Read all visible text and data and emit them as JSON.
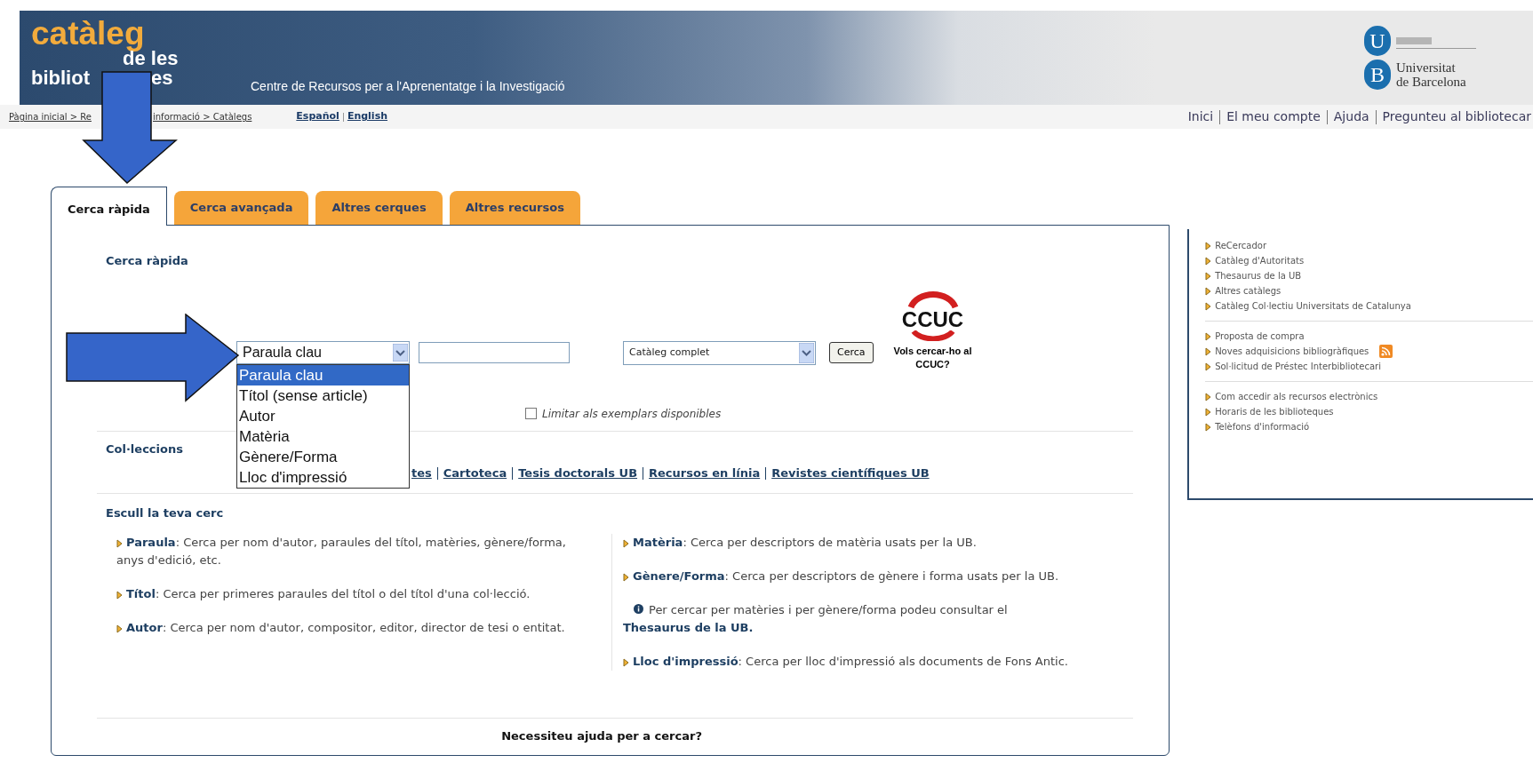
{
  "header": {
    "logo": {
      "title": "catàleg",
      "line_2": "de les",
      "line_3_start": "bibliot",
      "line_3_end": "es"
    },
    "subtitle": "Centre de Recursos per a l'Aprenentatge i la Investigació",
    "university": [
      "Universitat",
      "de Barcelona"
    ],
    "university_letters": [
      "U",
      "B"
    ]
  },
  "breadcrumb": [
    "Pàgina inicial > Re",
    "informació > Catàlegs"
  ],
  "languages": [
    "Español",
    "English"
  ],
  "top_links": [
    "Inici",
    "El meu compte",
    "Ajuda",
    "Pregunteu al bibliotecar"
  ],
  "tabs": [
    {
      "label": "Cerca ràpida",
      "selected": true
    },
    {
      "label": "Cerca avançada",
      "selected": false
    },
    {
      "label": "Altres cerques",
      "selected": false
    },
    {
      "label": "Altres recursos",
      "selected": false
    }
  ],
  "search": {
    "heading": "Cerca ràpida",
    "field_select": {
      "value": "Paraula clau",
      "expanded": true,
      "options": [
        {
          "label": "Paraula clau",
          "selected": true
        },
        {
          "label": "Títol (sense article)",
          "selected": false
        },
        {
          "label": "Autor",
          "selected": false
        },
        {
          "label": "Matèria",
          "selected": false
        },
        {
          "label": "Gènere/Forma",
          "selected": false
        },
        {
          "label": "Lloc d'impressió",
          "selected": false
        }
      ]
    },
    "catalog_select": "Catàleg complet",
    "button": "Cerca",
    "checkbox": {
      "label": "Limitar als exemplars disponibles",
      "checked": false
    },
    "ccuc": {
      "logo": "CCUC",
      "caption": "Vols cercar-ho al CCUC?"
    }
  },
  "collections": {
    "heading": "Col·leccions",
    "links": [
      "tes",
      "Cartoteca",
      "Tesis doctorals UB",
      "Recursos en línia",
      "Revistes científiques UB"
    ]
  },
  "choose": {
    "heading": "Escull la teva cerc",
    "left": [
      {
        "kind": "entry",
        "term": "Paraula",
        "text": ": Cerca per nom d'autor, paraules del títol, matèries, gènere/forma, anys d'edició, etc."
      },
      {
        "kind": "entry",
        "term": "Títol",
        "text": ": Cerca per primeres paraules del títol o del títol d'una col·lecció."
      },
      {
        "kind": "entry",
        "term": "Autor",
        "text": ": Cerca per nom d'autor, compositor, editor, director de tesi o entitat."
      }
    ],
    "right": [
      {
        "kind": "entry",
        "term": "Matèria",
        "text": ": Cerca per descriptors de matèria usats per la UB."
      },
      {
        "kind": "entry",
        "term": "Gènere/Forma",
        "text": ": Cerca per descriptors de gènere i forma usats per la UB."
      },
      {
        "kind": "note",
        "text": "Per cercar per matèries i per gènere/forma podeu consultar el",
        "term": "Thesaurus de la UB."
      },
      {
        "kind": "entry",
        "term": "Lloc d'impressió",
        "text": ": Cerca per lloc d'impressió als documents de Fons Antic."
      }
    ]
  },
  "help": "Necessiteu ajuda per a cercar?",
  "sidebar": [
    [
      {
        "label": "ReCercador",
        "feed": false
      },
      {
        "label": "Catàleg d'Autoritats",
        "feed": false
      },
      {
        "label": "Thesaurus de la UB",
        "feed": false
      },
      {
        "label": "Altres catàlegs",
        "feed": false
      },
      {
        "label": "Catàleg Col·lectiu Universitats de Catalunya",
        "feed": false
      }
    ],
    [
      {
        "label": "Proposta de compra",
        "feed": false
      },
      {
        "label": "Noves adquisicions bibliogràfiques",
        "feed": true
      },
      {
        "label": "Sol·licitud de Préstec Interbibliotecari",
        "feed": false
      }
    ],
    [
      {
        "label": "Com accedir als recursos electrònics",
        "feed": false
      },
      {
        "label": "Horaris de les biblioteques",
        "feed": false
      },
      {
        "label": "Telèfons d'informació",
        "feed": false
      }
    ]
  ]
}
